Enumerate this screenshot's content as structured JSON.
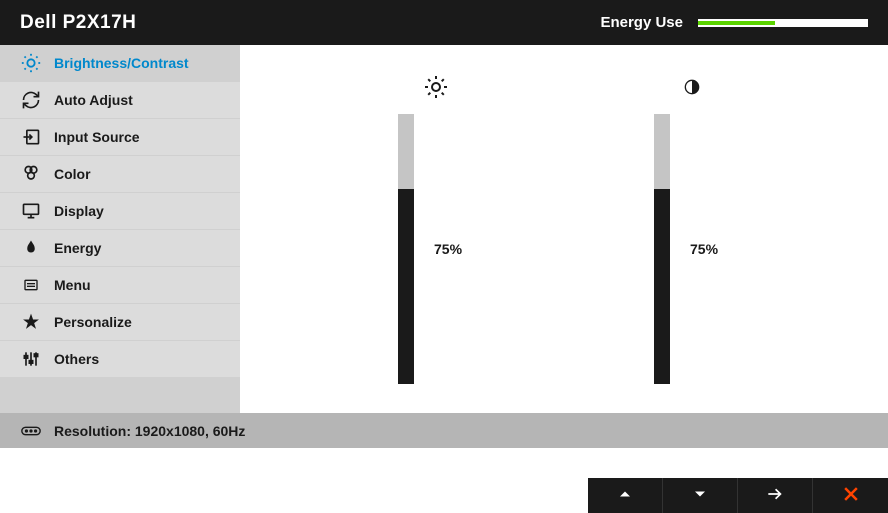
{
  "header": {
    "title": "Dell P2X17H",
    "energy_label": "Energy Use",
    "energy_percent": 45
  },
  "menu": {
    "items": [
      {
        "label": "Brightness/Contrast",
        "icon": "brightness"
      },
      {
        "label": "Auto Adjust",
        "icon": "sync"
      },
      {
        "label": "Input Source",
        "icon": "input"
      },
      {
        "label": "Color",
        "icon": "palette"
      },
      {
        "label": "Display",
        "icon": "monitor"
      },
      {
        "label": "Energy",
        "icon": "leaf"
      },
      {
        "label": "Menu",
        "icon": "menu-box"
      },
      {
        "label": "Personalize",
        "icon": "star"
      },
      {
        "label": "Others",
        "icon": "sliders"
      }
    ],
    "selected_index": 0
  },
  "sliders": {
    "brightness": {
      "value_text": "75%",
      "percent": 75
    },
    "contrast": {
      "value_text": "75%",
      "percent": 75
    }
  },
  "footer": {
    "resolution_text": "Resolution: 1920x1080, 60Hz"
  }
}
